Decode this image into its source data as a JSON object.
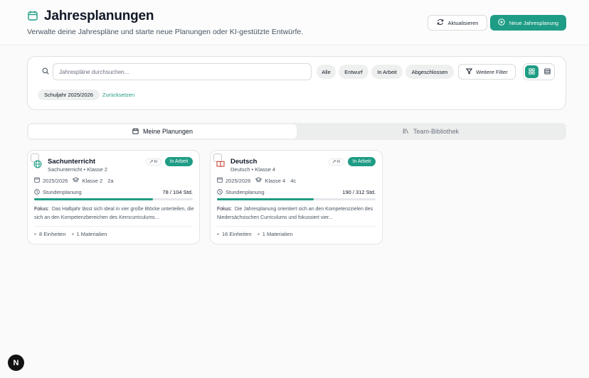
{
  "header": {
    "title": "Jahresplanungen",
    "subtitle": "Verwalte deine Jahrespläne und starte neue Planungen oder KI-gestützte Entwürfe.",
    "refresh_label": "Aktualisieren",
    "new_label": "Neue Jahresplanung"
  },
  "filters": {
    "search_placeholder": "Jahrespläne durchsuchen...",
    "status_pills": [
      "Alle",
      "Entwurf",
      "In Arbeit",
      "Abgeschlossen"
    ],
    "more_filters_label": "Weitere Filter",
    "active_chip": "Schuljahr 2025/2026",
    "reset_label": "Zurücksetzen"
  },
  "tabs": [
    {
      "label": "Meine Planungen",
      "active": true
    },
    {
      "label": "Team-Bibliothek",
      "active": false
    }
  ],
  "cards": [
    {
      "title": "Sachunterricht",
      "subtitle": "Sachunterricht • Klasse 2",
      "ki_label": "KI",
      "status": "In Arbeit",
      "year": "2025/2026",
      "grade": "Klasse 2",
      "class": "2a",
      "hours_label": "Stundenplanung",
      "hours_value": "78 / 104 Std.",
      "progress": 0.75,
      "focus_label": "Fokus:",
      "focus_text": "Das Halbjahr lässt sich ideal in vier große Blöcke unterteilen, die sich an den Kompetenzbereichen des Kerncurriculums...",
      "units": "8 Einheiten",
      "materials": "1 Materialien",
      "icon": "globe-icon"
    },
    {
      "title": "Deutsch",
      "subtitle": "Deutsch • Klasse 4",
      "ki_label": "KI",
      "status": "In Arbeit",
      "year": "2025/2026",
      "grade": "Klasse 4",
      "class": "4c",
      "hours_label": "Stundenplanung",
      "hours_value": "190 / 312 Std.",
      "progress": 0.61,
      "focus_label": "Fokus:",
      "focus_text": "Die Jahresplanung orientiert sich an den Kompetenzzielen des Niedersächsischen Curriculums und fokussiert vier...",
      "units": "16 Einheiten",
      "materials": "1 Materialien",
      "icon": "book-icon"
    }
  ],
  "colors": {
    "accent": "#1f9c85",
    "book_icon": "#c0392b"
  },
  "dev_badge": "N"
}
